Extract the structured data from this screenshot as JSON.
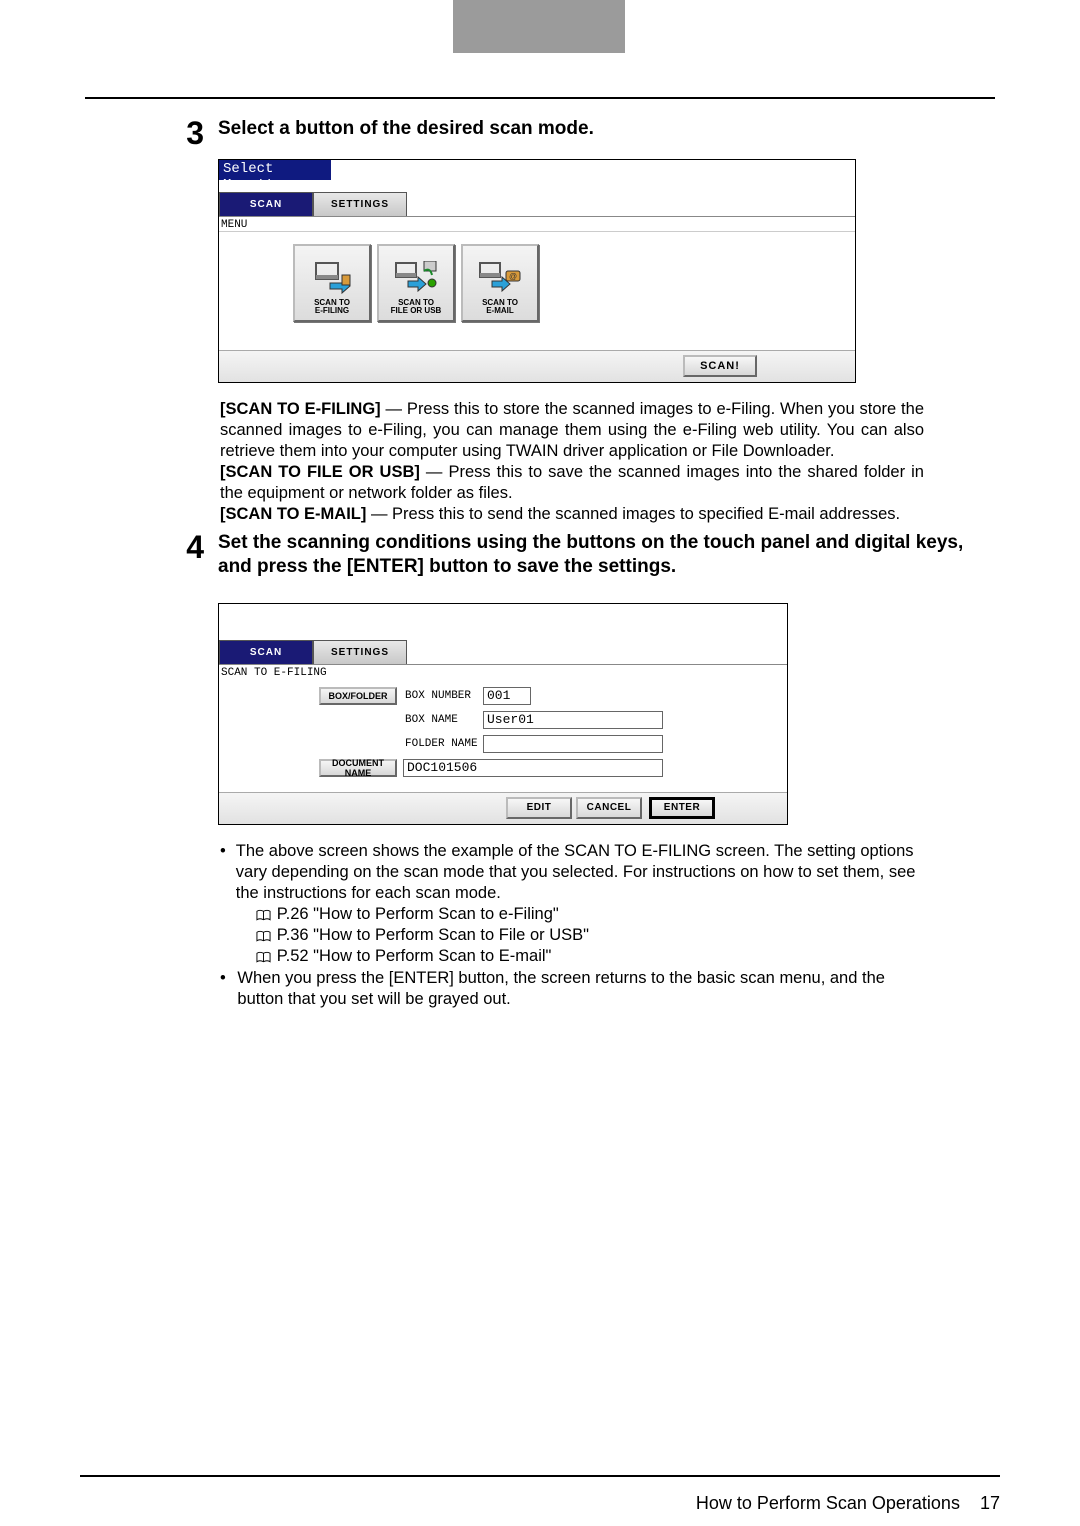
{
  "step3": {
    "num": "3",
    "title": "Select a button of the desired scan mode.",
    "ui": {
      "titlebar": "Select Menu!!",
      "tab_scan": "SCAN",
      "tab_settings": "SETTINGS",
      "subline": "MENU",
      "mode1_l1": "SCAN TO",
      "mode1_l2": "E-FILING",
      "mode2_l1": "SCAN TO",
      "mode2_l2": "FILE OR USB",
      "mode3_l1": "SCAN TO",
      "mode3_l2": "E-MAIL",
      "scan_btn": "SCAN!"
    },
    "desc": {
      "p1_b": "[SCAN TO E-FILING]",
      "p1": " — Press this to store the scanned images to e-Filing.  When you store the scanned images to e-Filing, you can manage them using the e-Filing web utility.  You can also retrieve them into your computer using TWAIN driver application or File Downloader.",
      "p2_b": "[SCAN TO FILE OR USB]",
      "p2": " — Press this to save the scanned images into the shared folder in the equipment or network folder as files.",
      "p3_b": "[SCAN TO E-MAIL]",
      "p3": " — Press this to send the scanned images to specified E-mail addresses."
    }
  },
  "step4": {
    "num": "4",
    "title": "Set the scanning conditions using the buttons on the touch panel and digital keys, and press the [ENTER] button to save the settings.",
    "ui": {
      "tab_scan": "SCAN",
      "tab_settings": "SETTINGS",
      "sub": "SCAN TO E-FILING",
      "btn_boxfolder": "BOX/FOLDER",
      "lbl_boxnum": "BOX NUMBER",
      "val_boxnum": "001",
      "lbl_boxname": "BOX NAME",
      "val_boxname": "User01",
      "lbl_foldername": "FOLDER NAME",
      "val_foldername": "",
      "btn_docname": "DOCUMENT NAME",
      "val_docname": "DOC101506",
      "btn_edit": "EDIT",
      "btn_cancel": "CANCEL",
      "btn_enter": "ENTER"
    },
    "bullets": {
      "b1": "The above screen shows the example of the SCAN TO E-FILING screen.  The setting options vary depending on the scan mode that you selected.  For instructions on how to set them, see the instructions for each scan mode.",
      "r1": "P.26 \"How to Perform Scan to e-Filing\"",
      "r2": "P.36 \"How to Perform Scan to File or USB\"",
      "r3": "P.52 \"How to Perform Scan to E-mail\"",
      "b2": "When you press the [ENTER] button, the screen returns to the basic scan menu, and the button that you set will be grayed out."
    }
  },
  "footer": {
    "text": "How to Perform Scan Operations",
    "page": "17"
  }
}
